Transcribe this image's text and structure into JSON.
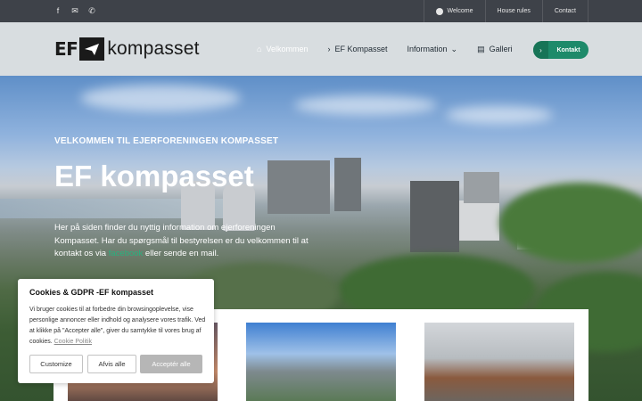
{
  "topbar": {
    "social": [
      {
        "icon": "facebook-icon",
        "glyph": "f"
      },
      {
        "icon": "mail-icon",
        "glyph": "✉"
      },
      {
        "icon": "phone-icon",
        "glyph": "✆"
      }
    ],
    "links": [
      {
        "label": "Welcome",
        "icon": "globe-icon"
      },
      {
        "label": "House rules"
      },
      {
        "label": "Contact"
      }
    ]
  },
  "header": {
    "logo_prefix": "EF",
    "logo_name": "kompasset",
    "nav": [
      {
        "label": "Velkommen",
        "icon": "house-icon",
        "glyph": "⌂",
        "active": true
      },
      {
        "label": "EF Kompasset",
        "icon": "chevron-right-icon",
        "glyph": "›"
      },
      {
        "label": "Information",
        "icon": "chevron-down-icon",
        "glyph": "⌄"
      },
      {
        "label": "Galleri",
        "icon": "gallery-icon",
        "glyph": "▤"
      }
    ],
    "contact_button": "Kontakt",
    "accent_color": "#1e8a6a"
  },
  "hero": {
    "kicker": "VELKOMMEN TIL EJERFORENINGEN KOMPASSET",
    "title": "EF kompasset",
    "text_before": "Her på siden finder du nyttig information om ejerforeningen Kompasset. Har du spørgsmål til bestyrelsen er du velkommen til at kontakt os via ",
    "text_link": "facebook",
    "text_after": " eller sende en mail."
  },
  "cookie": {
    "title": "Cookies & GDPR -EF kompasset",
    "body": "Vi bruger cookies til at forbedre din browsingoplevelse, vise personlige annoncer eller indhold og analysere vores trafik. Ved at klikke på \"Accepter alle\", giver du samtykke til vores brug af cookies. ",
    "policy_link": "Cookie Politik",
    "customize": "Customize",
    "reject": "Afvis alle",
    "accept": "Acceptér alle"
  }
}
